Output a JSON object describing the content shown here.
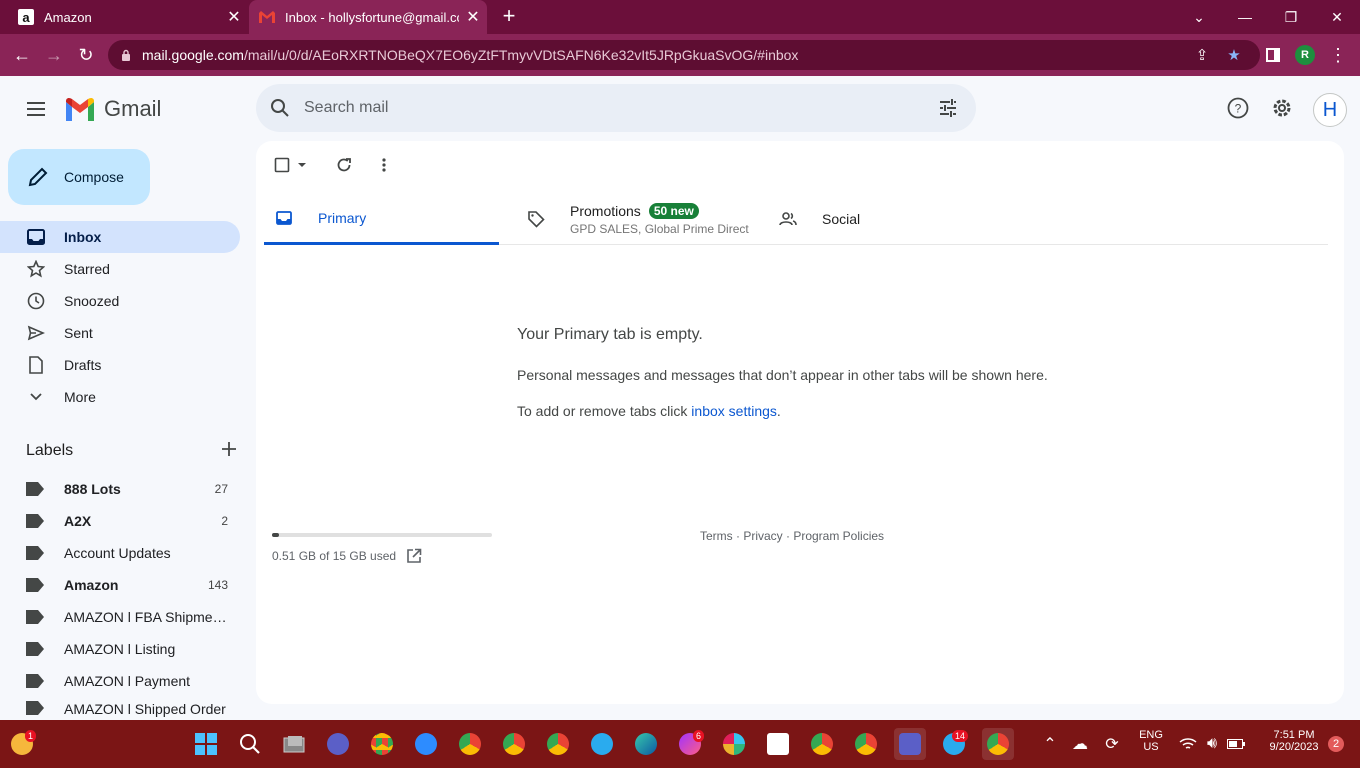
{
  "browser": {
    "tabs": [
      {
        "title": "Amazon",
        "favicon": "amazon-icon"
      },
      {
        "title": "Inbox - hollysfortune@gmail.com",
        "favicon": "gmail-icon"
      }
    ],
    "url_host": "mail.google.com",
    "url_path": "/mail/u/0/d/AEoRXRTNOBeQX7EO6yZtFTmyvVDtSAFN6Ke32vIt5JRpGkuaSvOG/#inbox",
    "profile_initial": "R"
  },
  "gmail": {
    "product_name": "Gmail",
    "search_placeholder": "Search mail",
    "account_initial": "H",
    "compose_label": "Compose",
    "nav": [
      {
        "label": "Inbox",
        "icon": "inbox-icon"
      },
      {
        "label": "Starred",
        "icon": "star-icon"
      },
      {
        "label": "Snoozed",
        "icon": "clock-icon"
      },
      {
        "label": "Sent",
        "icon": "send-icon"
      },
      {
        "label": "Drafts",
        "icon": "draft-icon"
      },
      {
        "label": "More",
        "icon": "chevron-down-icon"
      }
    ],
    "labels_title": "Labels",
    "labels": [
      {
        "name": "888 Lots",
        "count": "27"
      },
      {
        "name": "A2X",
        "count": "2"
      },
      {
        "name": "Account Updates",
        "count": ""
      },
      {
        "name": "Amazon",
        "count": "143"
      },
      {
        "name": "AMAZON l FBA Shipmen...",
        "count": ""
      },
      {
        "name": "AMAZON l Listing",
        "count": ""
      },
      {
        "name": "AMAZON l Payment",
        "count": ""
      },
      {
        "name": "AMAZON l Shipped Order",
        "count": ""
      }
    ],
    "tabs": {
      "primary": "Primary",
      "promotions": "Promotions",
      "promotions_badge": "50 new",
      "promotions_senders": "GPD SALES, Global Prime Direct",
      "social": "Social"
    },
    "empty_state": {
      "title": "Your Primary tab is empty.",
      "line1": "Personal messages and messages that don’t appear in other tabs will be shown here.",
      "line2_prefix": "To add or remove tabs click ",
      "line2_link": "inbox settings",
      "line2_suffix": "."
    },
    "storage": {
      "text": "0.51 GB of 15 GB used",
      "used_fraction": 0.034
    },
    "footer": "Terms · Privacy · Program Policies"
  },
  "taskbar": {
    "weather_badge": "1",
    "messenger_badge": "6",
    "telegram_badge": "14",
    "language_line1": "ENG",
    "language_line2": "US",
    "time": "7:51 PM",
    "date": "9/20/2023",
    "notification_count": "2"
  },
  "colors": {
    "tab_bar": "#6b0f3a",
    "address_bar": "#8a2457",
    "compose_bg": "#c2e7ff",
    "active_nav": "#d3e3fd",
    "primary_accent": "#0b57d0",
    "badge_green": "#188038",
    "taskbar": "#7b1515"
  }
}
